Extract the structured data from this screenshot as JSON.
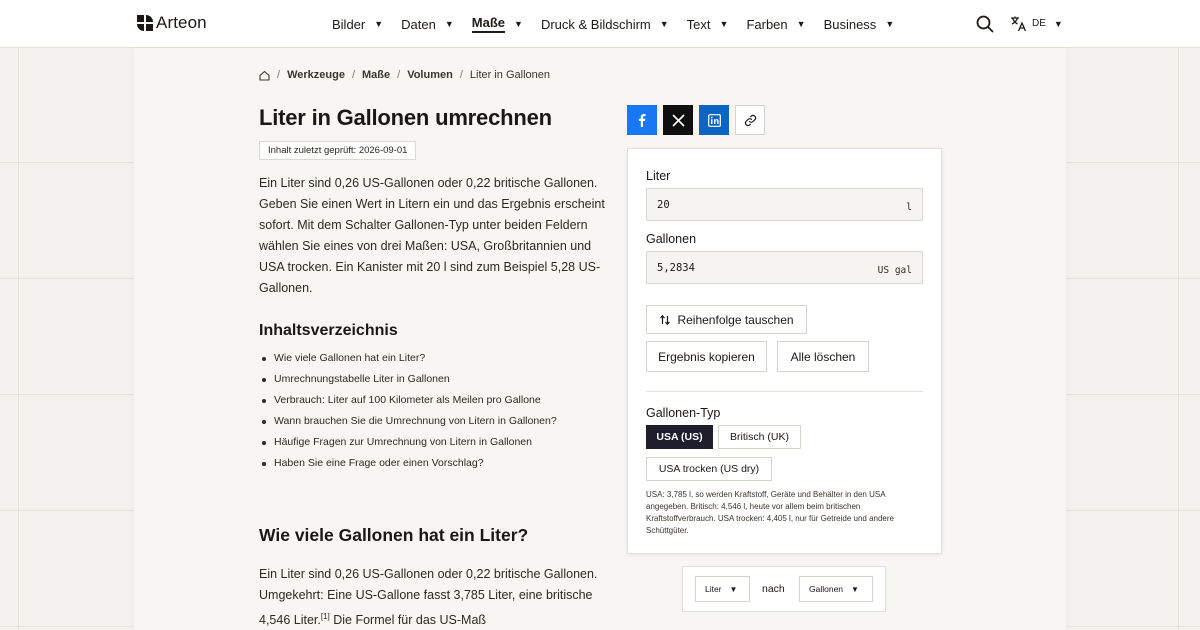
{
  "header": {
    "brand": "Arteon",
    "nav": [
      {
        "label": "Bilder",
        "active": false
      },
      {
        "label": "Daten",
        "active": false
      },
      {
        "label": "Maße",
        "active": true
      },
      {
        "label": "Druck & Bildschirm",
        "active": false
      },
      {
        "label": "Text",
        "active": false
      },
      {
        "label": "Farben",
        "active": false
      },
      {
        "label": "Business",
        "active": false
      }
    ],
    "language": "DE"
  },
  "breadcrumb": {
    "items": [
      "Werkzeuge",
      "Maße",
      "Volumen"
    ],
    "current": "Liter in Gallonen"
  },
  "page": {
    "title": "Liter in Gallonen umrechnen",
    "checked": "Inhalt zuletzt geprüft: 2026-09-01",
    "intro": "Ein Liter sind 0,26 US-Gallonen oder 0,22 britische Gallonen. Geben Sie einen Wert in Litern ein und das Ergebnis erscheint sofort. Mit dem Schalter Gallonen-Typ unter beiden Feldern wählen Sie eines von drei Maßen: USA, Großbritannien und USA trocken. Ein Kanister mit 20 l sind zum Beispiel 5,28 US-Gallonen."
  },
  "toc": {
    "title": "Inhaltsverzeichnis",
    "items": [
      "Wie viele Gallonen hat ein Liter?",
      "Umrechnungstabelle Liter in Gallonen",
      "Verbrauch: Liter auf 100 Kilometer als Meilen pro Gallone",
      "Wann brauchen Sie die Umrechnung von Litern in Gallonen?",
      "Häufige Fragen zur Umrechnung von Litern in Gallonen",
      "Haben Sie eine Frage oder einen Vorschlag?"
    ]
  },
  "section": {
    "title": "Wie viele Gallonen hat ein Liter?",
    "text_before": "Ein Liter sind 0,26 US-Gallonen oder 0,22 britische Gallonen. Umgekehrt: Eine US-Gallone fasst 3,785 Liter, eine britische 4,546 Liter.",
    "footnote": "[1]",
    "text_after": " Die Formel für das US-Maß"
  },
  "share": {
    "icons": [
      "facebook-icon",
      "x-icon",
      "linkedin-icon",
      "link-icon"
    ]
  },
  "converter": {
    "from_label": "Liter",
    "from_value": "20",
    "from_unit": "l",
    "to_label": "Gallonen",
    "to_value": "5,2834",
    "to_unit": "US gal",
    "swap_label": "Reihenfolge tauschen",
    "copy_label": "Ergebnis kopieren",
    "clear_label": "Alle löschen",
    "type_label": "Gallonen-Typ",
    "types": [
      {
        "label": "USA (US)",
        "active": true
      },
      {
        "label": "Britisch (UK)",
        "active": false
      },
      {
        "label": "USA trocken (US dry)",
        "active": false
      }
    ],
    "note": "USA: 3,785 l, so werden Kraftstoff, Geräte und Behälter in den USA angegeben. Britisch: 4,546 l, heute vor allem beim britischen Kraftstoffverbrauch. USA trocken: 4,405 l, nur für Getreide und andere Schüttgüter."
  },
  "unit_selector": {
    "from": "Liter",
    "connector": "nach",
    "to": "Gallonen"
  },
  "colors": {
    "accent_dark": "#1f1e2c",
    "facebook": "#1877f2",
    "x": "#0f0f0f",
    "linkedin": "#0a66c2"
  }
}
